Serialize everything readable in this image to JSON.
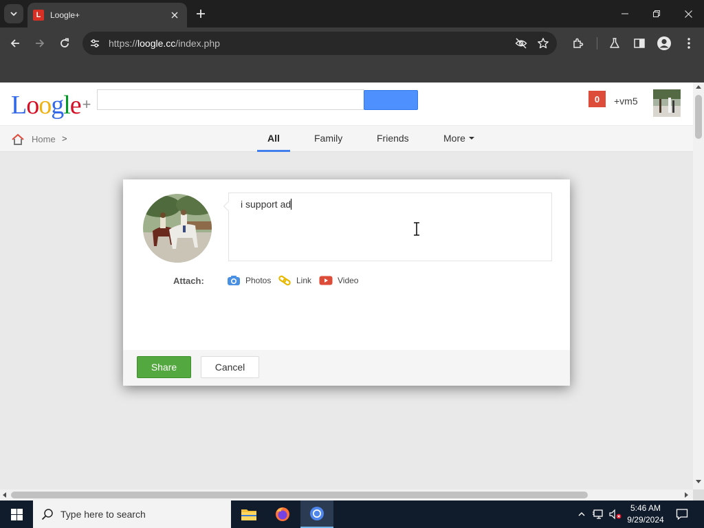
{
  "browser": {
    "tab_title": "Loogle+",
    "favicon_glyph": "L",
    "url_prefix": "https://",
    "url_host": "loogle.cc",
    "url_path": "/index.php"
  },
  "site": {
    "logo_letters": [
      {
        "char": "L",
        "color": "#3369e8"
      },
      {
        "char": "o",
        "color": "#d50f25"
      },
      {
        "char": "o",
        "color": "#eeb211"
      },
      {
        "char": "g",
        "color": "#3369e8"
      },
      {
        "char": "l",
        "color": "#009925"
      },
      {
        "char": "e",
        "color": "#d50f25"
      }
    ],
    "logo_plus": "+",
    "search_value": "",
    "search_button_label": "",
    "notification_count": "0",
    "user_name": "+vm5"
  },
  "subnav": {
    "home_label": "Home",
    "separator": ">",
    "tabs": [
      {
        "label": "All",
        "active": true
      },
      {
        "label": "Family",
        "active": false
      },
      {
        "label": "Friends",
        "active": false
      },
      {
        "label": "More",
        "active": false
      }
    ]
  },
  "dialog": {
    "post_text": "i support ad",
    "attach_label": "Attach:",
    "attach_items": [
      {
        "label": "Photos",
        "icon": "camera-icon"
      },
      {
        "label": "Link",
        "icon": "link-icon"
      },
      {
        "label": "Video",
        "icon": "video-icon"
      }
    ],
    "share_label": "Share",
    "cancel_label": "Cancel"
  },
  "taskbar": {
    "search_placeholder": "Type here to search",
    "time": "5:46 AM",
    "date": "9/29/2024"
  },
  "colors": {
    "accent_blue": "#427fed",
    "share_green": "#53a93f",
    "notification_red": "#dd4b39"
  }
}
